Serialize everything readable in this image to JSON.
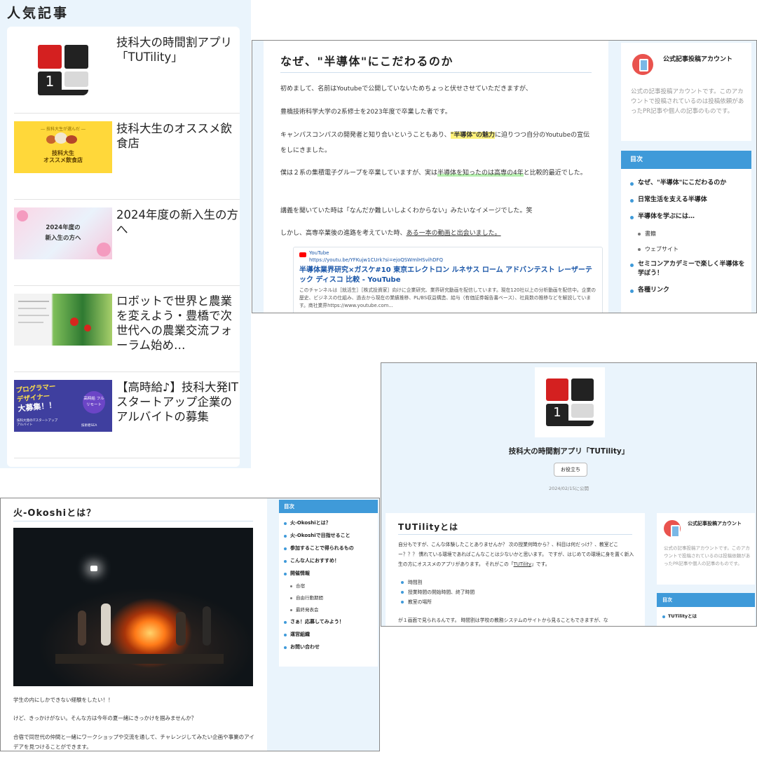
{
  "popular": {
    "heading": "人気記事",
    "articles": [
      {
        "title": "技科大の時間割アプリ「TUTility」"
      },
      {
        "title": "技科大生のオススメ飲食店",
        "thumb_top": "― 技科大生が選んだ ―",
        "thumb_line1": "技科大生",
        "thumb_line2": "オススメ飲食店"
      },
      {
        "title": "2024年度の新入生の方へ",
        "thumb_line1": "2024年度の",
        "thumb_line2": "新入生の方へ"
      },
      {
        "title": "ロボットで世界と農業を変えよう・豊橋で次世代への農業交流フォーラム始め…"
      },
      {
        "title": "【高時給♪】技科大発ITスタートアップ企業のアルバイトの募集",
        "thumb_line1": "プログラマー",
        "thumb_line2": "デザイナー",
        "thumb_line3": "大募集！！",
        "thumb_badge": "高時給 フルリモート",
        "thumb_foot": "技科大発のITスタートアップ",
        "thumb_foot2": "アルバイト",
        "thumb_tag": "技術者SEA"
      }
    ]
  },
  "semi": {
    "title": "なぜ、\"半導体\"にこだわるのか",
    "p1": "初めまして、名前はYoutubeで公開していないためちょっと伏せさせていただきますが、",
    "p2": "豊橋技術科学大学の2系修士を2023年度で卒業した者です。",
    "p3a": "キャンパスコンパスの開発者と知り合いということもあり、",
    "p3b": "\"半導体\"の魅力",
    "p3c": "に迫りつつ自分のYoutubeの宣伝をしにきました。",
    "p4a": "僕は２系の集積電子グループを卒業していますが、実は",
    "p4b": "半導体を知ったのは高専の4年",
    "p4c": "と比較的最近でした。",
    "p5": "講義を聞いていた時は「なんだか難しいしよくわからない」みたいなイメージでした。笑",
    "p6a": "しかし、高専卒業後の進路を考えていた時、",
    "p6b": "ある一本の動画と出会いました。",
    "yt_source": "YouTube",
    "yt_url": "https://youtu.be/YFKujw1CUrk?si=ejoQSWmlHSvihDFQ",
    "yt_title": "半導体業界研究×ガスケ#10 東京エレクトロン ルネサス ローム アドバンテスト レーザーテック ディスコ 比較 - YouTube",
    "yt_desc": "このチャンネルは［就活生］［株式投資家］向けに企業研究、業界研究動画を配信しています。現在120社以上の分析動画を配信中。企業の歴史、ビジネスの仕組み、過去から現在の業績推移、PL/BS収益構造、給与（有価証券報告書ベース）、社員数の推移などを解説しています。商社業界https://www.youtube.com...",
    "account_name": "公式記事投稿アカウント",
    "account_desc": "公式の記事投稿アカウントです。このアカウントで投稿されているのは投稿依頼があったPR記事や個人の記事のものです。",
    "toc_heading": "目次",
    "toc": [
      {
        "label": "なぜ、\"半導体\"にこだわるのか",
        "level": 1
      },
      {
        "label": "日常生活を支える半導体",
        "level": 1
      },
      {
        "label": "半導体を学ぶには…",
        "level": 1
      },
      {
        "label": "書籍",
        "level": 2
      },
      {
        "label": "ウェブサイト",
        "level": 2
      },
      {
        "label": "セミコンアカデミーで楽しく半導体を学ぼう！",
        "level": 1
      },
      {
        "label": "各種リンク",
        "level": 1
      }
    ]
  },
  "fire": {
    "title": "火-Okoshiとは？",
    "p1": "学生の内にしかできない経験をしたい！！",
    "p2": "けど、きっかけがない。そんな方は今年の夏一緒にきっかけを掴みませんか？",
    "p3": "合宿で同世代の仲間と一緒にワークショップや交流を通して、チャレンジしてみたい企画や事業のアイデアを見つけることができます。",
    "toc_heading": "目次",
    "toc": [
      {
        "label": "火-Okoshiとは？",
        "level": 1
      },
      {
        "label": "火-Okoshiで目指せること",
        "level": 1
      },
      {
        "label": "参加することで得られるもの",
        "level": 1
      },
      {
        "label": "こんな人におすすめ！",
        "level": 1
      },
      {
        "label": "開催情報",
        "level": 1
      },
      {
        "label": "合宿",
        "level": 2
      },
      {
        "label": "自由行動期間",
        "level": 2
      },
      {
        "label": "最終発表会",
        "level": 2
      },
      {
        "label": "さぁ！応募してみよう！",
        "level": 1
      },
      {
        "label": "運営組織",
        "level": 1
      },
      {
        "label": "お問い合わせ",
        "level": 1
      }
    ]
  },
  "tutility": {
    "app_title": "技科大の時間割アプリ「TUTility」",
    "category": "お役立ち",
    "date": "2024/02/15に公開",
    "section_title": "TUTilityとは",
    "p1a": "自分もですが、こんな体験したことありませんか？ 次の授業何時から？、科目は何だっけ？、教室どこー？？？ 慣れている環境であればこんなことは少ないかと思います。 ですが、はじめての環境に身を置く新入生の方にオススメのアプリがあります。 それがこの「",
    "p1b": "TUTility",
    "p1c": "」です。",
    "bullets": [
      "時間割",
      "授業時間の開始時間、終了時間",
      "教室の場所"
    ],
    "p2": "が１画面で見られるんです。 時間割は学校の教務システムのサイトから見ることもできますが、な",
    "account_name": "公式記事投稿アカウント",
    "account_desc": "公式の記事投稿アカウントです。このアカウントで投稿されているのは投稿依頼があったPR記事や個人の記事のものです。",
    "toc_heading": "目次",
    "toc": [
      {
        "label": "TUTilityとは",
        "level": 1
      }
    ]
  },
  "logo_digit": "1",
  "colors": {
    "accent": "#3f9ad9",
    "logo_red": "#d42020",
    "logo_dark": "#222222",
    "logo_light": "#d9d9d9",
    "highlight_yellow": "#fff27a",
    "yt_red": "#ff0000"
  }
}
